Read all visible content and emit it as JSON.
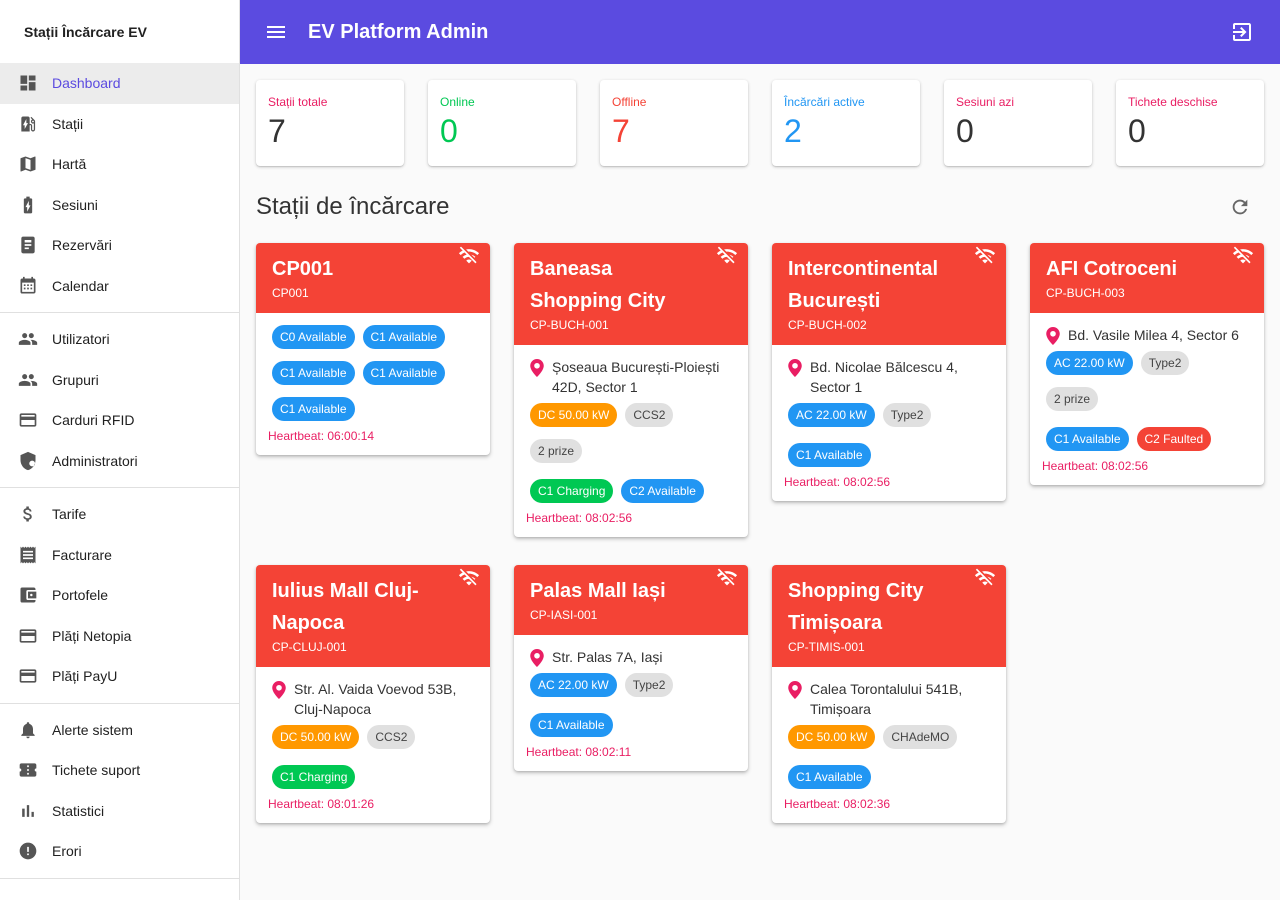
{
  "sidebar": {
    "title": "Stații Încărcare EV",
    "groups": [
      [
        {
          "label": "Dashboard",
          "icon": "dashboard-icon",
          "active": true
        },
        {
          "label": "Stații",
          "icon": "ev-station-icon"
        },
        {
          "label": "Hartă",
          "icon": "map-icon"
        },
        {
          "label": "Sesiuni",
          "icon": "battery-charging-icon"
        },
        {
          "label": "Rezervări",
          "icon": "ticket-icon"
        },
        {
          "label": "Calendar",
          "icon": "calendar-icon"
        }
      ],
      [
        {
          "label": "Utilizatori",
          "icon": "people-icon"
        },
        {
          "label": "Grupuri",
          "icon": "groups-icon"
        },
        {
          "label": "Carduri RFID",
          "icon": "credit-card-icon"
        },
        {
          "label": "Administratori",
          "icon": "admin-shield-icon"
        }
      ],
      [
        {
          "label": "Tarife",
          "icon": "dollar-icon"
        },
        {
          "label": "Facturare",
          "icon": "receipt-icon"
        },
        {
          "label": "Portofele",
          "icon": "wallet-icon"
        },
        {
          "label": "Plăți Netopia",
          "icon": "credit-card-icon"
        },
        {
          "label": "Plăți PayU",
          "icon": "credit-card-icon"
        }
      ],
      [
        {
          "label": "Alerte sistem",
          "icon": "bell-alert-icon"
        },
        {
          "label": "Tichete suport",
          "icon": "support-ticket-icon"
        },
        {
          "label": "Statistici",
          "icon": "bar-chart-icon"
        },
        {
          "label": "Erori",
          "icon": "error-icon"
        }
      ]
    ]
  },
  "topbar": {
    "title": "EV Platform Admin"
  },
  "stats": [
    {
      "label": "Stații totale",
      "value": "7",
      "label_color": "#e91e63",
      "value_color": "#333333"
    },
    {
      "label": "Online",
      "value": "0",
      "label_color": "#00c853",
      "value_color": "#00c853"
    },
    {
      "label": "Offline",
      "value": "7",
      "label_color": "#f44336",
      "value_color": "#f44336"
    },
    {
      "label": "Încărcări active",
      "value": "2",
      "label_color": "#2196f3",
      "value_color": "#2196f3"
    },
    {
      "label": "Sesiuni azi",
      "value": "0",
      "label_color": "#e91e63",
      "value_color": "#333333"
    },
    {
      "label": "Tichete deschise",
      "value": "0",
      "label_color": "#e91e63",
      "value_color": "#333333"
    }
  ],
  "section_title": "Stații de încărcare",
  "stations": [
    {
      "name": "CP001",
      "id": "CP001",
      "address": "",
      "specs": [],
      "connectors": [
        {
          "label": "C0 Available",
          "color": "blue"
        },
        {
          "label": "C1 Available",
          "color": "blue"
        },
        {
          "label": "C1 Available",
          "color": "blue"
        },
        {
          "label": "C1 Available",
          "color": "blue"
        },
        {
          "label": "C1 Available",
          "color": "blue"
        }
      ],
      "heartbeat": "Heartbeat: 06:00:14"
    },
    {
      "name": "Baneasa Shopping City",
      "id": "CP-BUCH-001",
      "address": "Șoseaua București-Ploiești 42D, Sector 1",
      "specs": [
        {
          "label": "DC 50.00 kW",
          "color": "orange"
        },
        {
          "label": "CCS2",
          "color": "gray"
        },
        {
          "label": "2 prize",
          "color": "gray"
        }
      ],
      "connectors": [
        {
          "label": "C1 Charging",
          "color": "green"
        },
        {
          "label": "C2 Available",
          "color": "blue"
        }
      ],
      "heartbeat": "Heartbeat: 08:02:56"
    },
    {
      "name": "Intercontinental București",
      "id": "CP-BUCH-002",
      "address": "Bd. Nicolae Bălcescu 4, Sector 1",
      "specs": [
        {
          "label": "AC 22.00 kW",
          "color": "blue"
        },
        {
          "label": "Type2",
          "color": "gray"
        }
      ],
      "connectors": [
        {
          "label": "C1 Available",
          "color": "blue"
        }
      ],
      "heartbeat": "Heartbeat: 08:02:56"
    },
    {
      "name": "AFI Cotroceni",
      "id": "CP-BUCH-003",
      "address": "Bd. Vasile Milea 4, Sector 6",
      "specs": [
        {
          "label": "AC 22.00 kW",
          "color": "blue"
        },
        {
          "label": "Type2",
          "color": "gray"
        },
        {
          "label": "2 prize",
          "color": "gray"
        }
      ],
      "connectors": [
        {
          "label": "C1 Available",
          "color": "blue"
        },
        {
          "label": "C2 Faulted",
          "color": "red"
        }
      ],
      "heartbeat": "Heartbeat: 08:02:56"
    },
    {
      "name": "Iulius Mall Cluj-Napoca",
      "id": "CP-CLUJ-001",
      "address": "Str. Al. Vaida Voevod 53B, Cluj-Napoca",
      "specs": [
        {
          "label": "DC 50.00 kW",
          "color": "orange"
        },
        {
          "label": "CCS2",
          "color": "gray"
        }
      ],
      "connectors": [
        {
          "label": "C1 Charging",
          "color": "green"
        }
      ],
      "heartbeat": "Heartbeat: 08:01:26"
    },
    {
      "name": "Palas Mall Iași",
      "id": "CP-IASI-001",
      "address": "Str. Palas 7A, Iași",
      "specs": [
        {
          "label": "AC 22.00 kW",
          "color": "blue"
        },
        {
          "label": "Type2",
          "color": "gray"
        }
      ],
      "connectors": [
        {
          "label": "C1 Available",
          "color": "blue"
        }
      ],
      "heartbeat": "Heartbeat: 08:02:11"
    },
    {
      "name": "Shopping City Timișoara",
      "id": "CP-TIMIS-001",
      "address": "Calea Torontalului 541B, Timișoara",
      "specs": [
        {
          "label": "DC 50.00 kW",
          "color": "orange"
        },
        {
          "label": "CHAdeMO",
          "color": "gray"
        }
      ],
      "connectors": [
        {
          "label": "C1 Available",
          "color": "blue"
        }
      ],
      "heartbeat": "Heartbeat: 08:02:36"
    }
  ]
}
